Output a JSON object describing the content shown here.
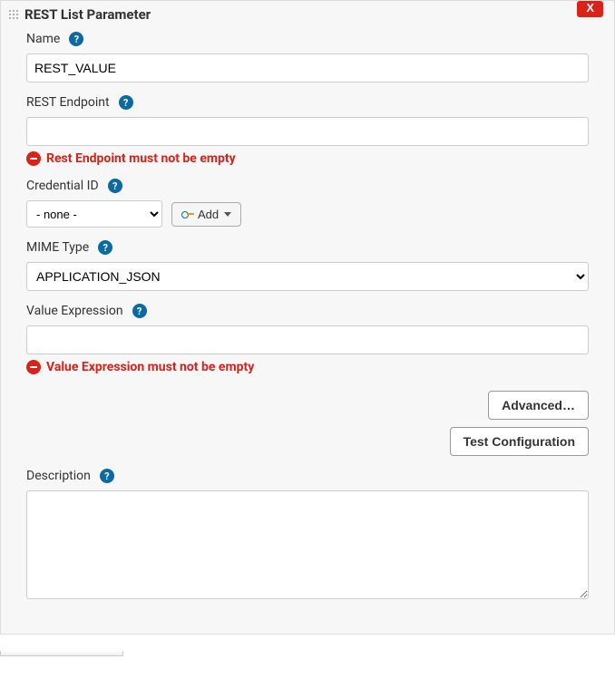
{
  "header": {
    "title": "REST List Parameter",
    "close_label": "X"
  },
  "fields": {
    "name": {
      "label": "Name",
      "value": "REST_VALUE"
    },
    "rest_endpoint": {
      "label": "REST Endpoint",
      "value": "",
      "error": "Rest Endpoint must not be empty"
    },
    "credential_id": {
      "label": "Credential ID",
      "selected": "- none -",
      "add_label": "Add"
    },
    "mime_type": {
      "label": "MIME Type",
      "selected": "APPLICATION_JSON"
    },
    "value_expression": {
      "label": "Value Expression",
      "value": "",
      "error": "Value Expression must not be empty"
    },
    "description": {
      "label": "Description",
      "value": ""
    }
  },
  "actions": {
    "advanced": "Advanced…",
    "test_config": "Test Configuration"
  },
  "help_glyph": "?"
}
